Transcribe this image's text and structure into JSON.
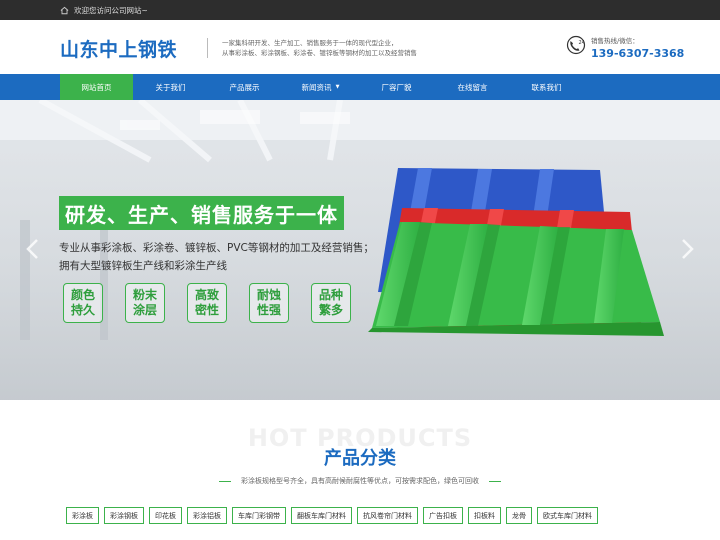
{
  "topbar": {
    "welcome": "欢迎您访问公司网站~"
  },
  "header": {
    "logo": "山东中上钢铁",
    "slogan_line1": "一家集科研开发、生产加工、销售服务于一体的现代型企业，",
    "slogan_line2": "从事彩涂板、彩涂钢板、彩涂卷、镀锌板等钢材的加工以及经营销售",
    "hotline_label": "销售热线/微信：",
    "hotline_number": "139-6307-3368",
    "phone_badge": "24"
  },
  "nav": {
    "items": [
      {
        "label": "网站首页",
        "active": true
      },
      {
        "label": "关于我们"
      },
      {
        "label": "产品展示"
      },
      {
        "label": "新闻资讯",
        "has_dropdown": true
      },
      {
        "label": "厂容厂貌"
      },
      {
        "label": "在线留言"
      },
      {
        "label": "联系我们"
      }
    ],
    "dropdown_glyph": "▼"
  },
  "hero": {
    "title": "研发、生产、销售服务于一体",
    "line1": "专业从事彩涂板、彩涂卷、镀锌板、PVC等钢材的加工及经营销售；",
    "line2": "拥有大型镀锌板生产线和彩涂生产线",
    "features": [
      {
        "l1": "颜色",
        "l2": "持久"
      },
      {
        "l1": "粉末",
        "l2": "涂层"
      },
      {
        "l1": "高致",
        "l2": "密性"
      },
      {
        "l1": "耐蚀",
        "l2": "性强"
      },
      {
        "l1": "品种",
        "l2": "繁多"
      }
    ]
  },
  "products": {
    "en_title": "HOT PRODUCTS",
    "title": "产品分类",
    "subtitle": "彩涂板规格型号齐全，具有高耐候耐腐性等优点，可按需求配色，绿色可回收",
    "categories": [
      "彩涂板",
      "彩涂钢板",
      "印花板",
      "彩涂铝板",
      "车库门彩钢带",
      "翻板车库门材料",
      "抗风卷帘门材料",
      "广告扣板",
      "扣板料",
      "龙骨",
      "欧式车库门材料"
    ]
  },
  "colors": {
    "brand_blue": "#1c6bc0",
    "accent_green": "#3cb24b",
    "topbar_bg": "#2d2d2d"
  }
}
